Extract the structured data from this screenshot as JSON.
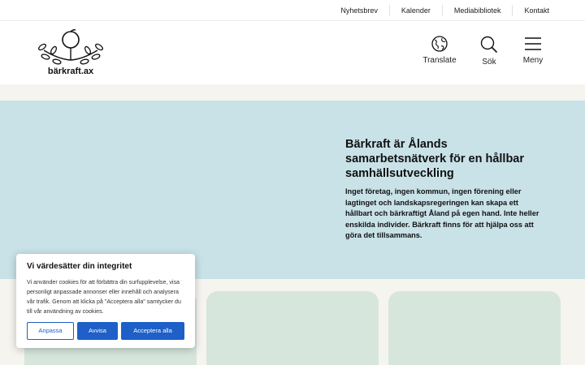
{
  "topbar": {
    "links": [
      "Nyhetsbrev",
      "Kalender",
      "Mediabibliotek",
      "Kontakt"
    ]
  },
  "header": {
    "logo_text": "bärkraft.ax",
    "translate_label": "Translate",
    "search_label": "Sök",
    "menu_label": "Meny"
  },
  "hero": {
    "heading": "Bärkraft är Ålands samarbetsnätverk för en hållbar samhällsutveckling",
    "body": "Inget företag, ingen kommun, ingen förening eller lagtinget och landskapsregeringen kan skapa ett hållbart och bärkraftigt Åland på egen hand. Inte heller enskilda individer. Bärkraft finns för att hjälpa oss att göra det tillsammans."
  },
  "cookie": {
    "title": "Vi värdesätter din integritet",
    "text": "Vi använder cookies för att förbättra din surfupplevelse, visa personligt anpassade annonser eller innehåll och analysera vår trafik. Genom att klicka på \"Acceptera alla\" samtycker du till vår användning av cookies.",
    "customize_label": "Anpassa",
    "reject_label": "Avvisa",
    "accept_label": "Acceptera alla"
  },
  "icons": {
    "translate": "globe-icon",
    "search": "search-icon",
    "menu": "hamburger-icon"
  },
  "colors": {
    "hero_bg": "#c8e2e8",
    "card_bg": "#d6e6dc",
    "section_bg": "#f6f4ef",
    "button_blue": "#1e5fc8"
  }
}
